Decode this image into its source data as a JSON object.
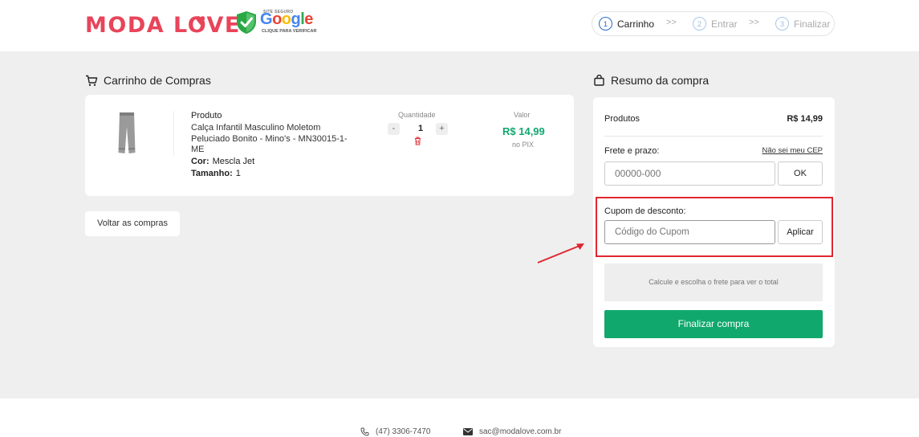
{
  "header": {
    "logo_text": "MODA LOVE",
    "seal": {
      "top_text": "SITE SEGURO",
      "brand": "Google",
      "bottom_text": "CLIQUE PARA VERIFICAR"
    },
    "steps": [
      {
        "num": "1",
        "label": "Carrinho"
      },
      {
        "num": "2",
        "label": "Entrar"
      },
      {
        "num": "3",
        "label": "Finalizar"
      }
    ],
    "step_separator": ">>"
  },
  "cart": {
    "title": "Carrinho de Compras",
    "product_label": "Produto",
    "product_name": "Calça Infantil Masculino Moletom Peluciado Bonito - Mino's - MN30015-1-ME",
    "color_label": "Cor:",
    "color_value": "Mescla Jet",
    "size_label": "Tamanho:",
    "size_value": "1",
    "qty_label": "Quantidade",
    "qty_minus": "-",
    "qty_value": "1",
    "qty_plus": "+",
    "value_label": "Valor",
    "price": "R$ 14,99",
    "pix_label": "no PIX",
    "back_button": "Voltar as compras"
  },
  "summary": {
    "title": "Resumo da compra",
    "products_label": "Produtos",
    "products_value": "R$ 14,99",
    "shipping_label": "Frete e prazo:",
    "cep_link": "Não sei meu CEP",
    "cep_placeholder": "00000-000",
    "ok_button": "OK",
    "coupon_label": "Cupom de desconto:",
    "coupon_placeholder": "Código do Cupom",
    "apply_button": "Aplicar",
    "total_hint": "Calcule e escolha o frete para ver o total",
    "finish_button": "Finalizar compra"
  },
  "footer": {
    "phone": "(47) 3306-7470",
    "email": "sac@modalove.com.br"
  },
  "colors": {
    "brand": "#e8445a",
    "primary_green": "#10a86d",
    "step_active": "#2a6bc4",
    "highlight_red": "#e0262f"
  }
}
